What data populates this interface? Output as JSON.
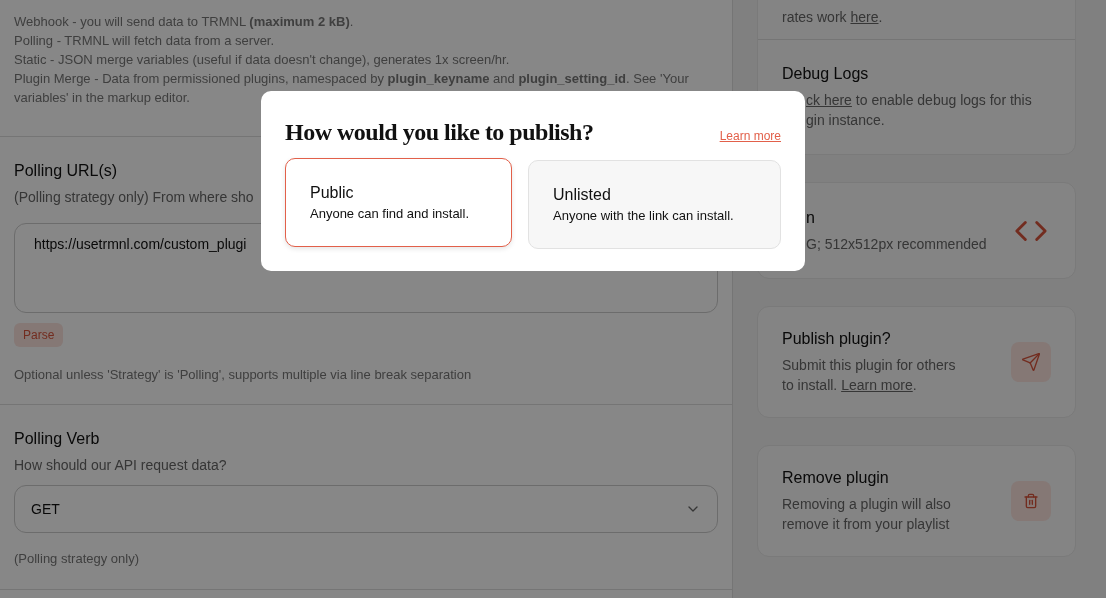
{
  "strategy_help": [
    "Webhook - you will send data to TRMNL **(maximum 2 kB)**.",
    "Polling - TRMNL will fetch data from a server.",
    "Static - JSON merge variables (useful if data doesn't change), generates 1x screen/hr.",
    "Plugin Merge - Data from permissioned plugins, namespaced by **plugin_keyname** and **plugin_setting_id**. See 'Your variables' in the markup editor."
  ],
  "polling_urls": {
    "title": "Polling URL(s)",
    "description": "(Polling strategy only) From where sho",
    "value": "https://usetrmnl.com/custom_plugi",
    "button": "Parse",
    "help": "Optional unless 'Strategy' is 'Polling', supports multiple via line break separation"
  },
  "polling_verb": {
    "title": "Polling Verb",
    "description": "How should our API request data?",
    "value": "GET",
    "help": "(Polling strategy only)"
  },
  "sidebar": {
    "refresh_note": {
      "text": "rates work ",
      "link": "here",
      "tail": "."
    },
    "debug_logs": {
      "title": "Debug Logs",
      "link": "ck here",
      "text": " to enable debug logs for this",
      "line2": "gin instance."
    },
    "cards": [
      {
        "kind": "icon",
        "title": "n",
        "description": "G; 512x512px recommended",
        "partial": true
      },
      {
        "kind": "publish",
        "title": "Publish plugin?",
        "description": "Submit this plugin for others to install. ",
        "link": "Learn more",
        "tail": ".",
        "partial": false
      },
      {
        "kind": "remove",
        "title": "Remove plugin",
        "description": "Removing a plugin will also remove it from your playlist",
        "partial": false
      }
    ]
  },
  "modal": {
    "title": "How would you like to publish?",
    "link": "Learn more",
    "options": [
      {
        "label": "Public",
        "description": "Anyone can find and install.",
        "selected": true
      },
      {
        "label": "Unlisted",
        "description": "Anyone with the link can install.",
        "selected": false
      }
    ]
  }
}
